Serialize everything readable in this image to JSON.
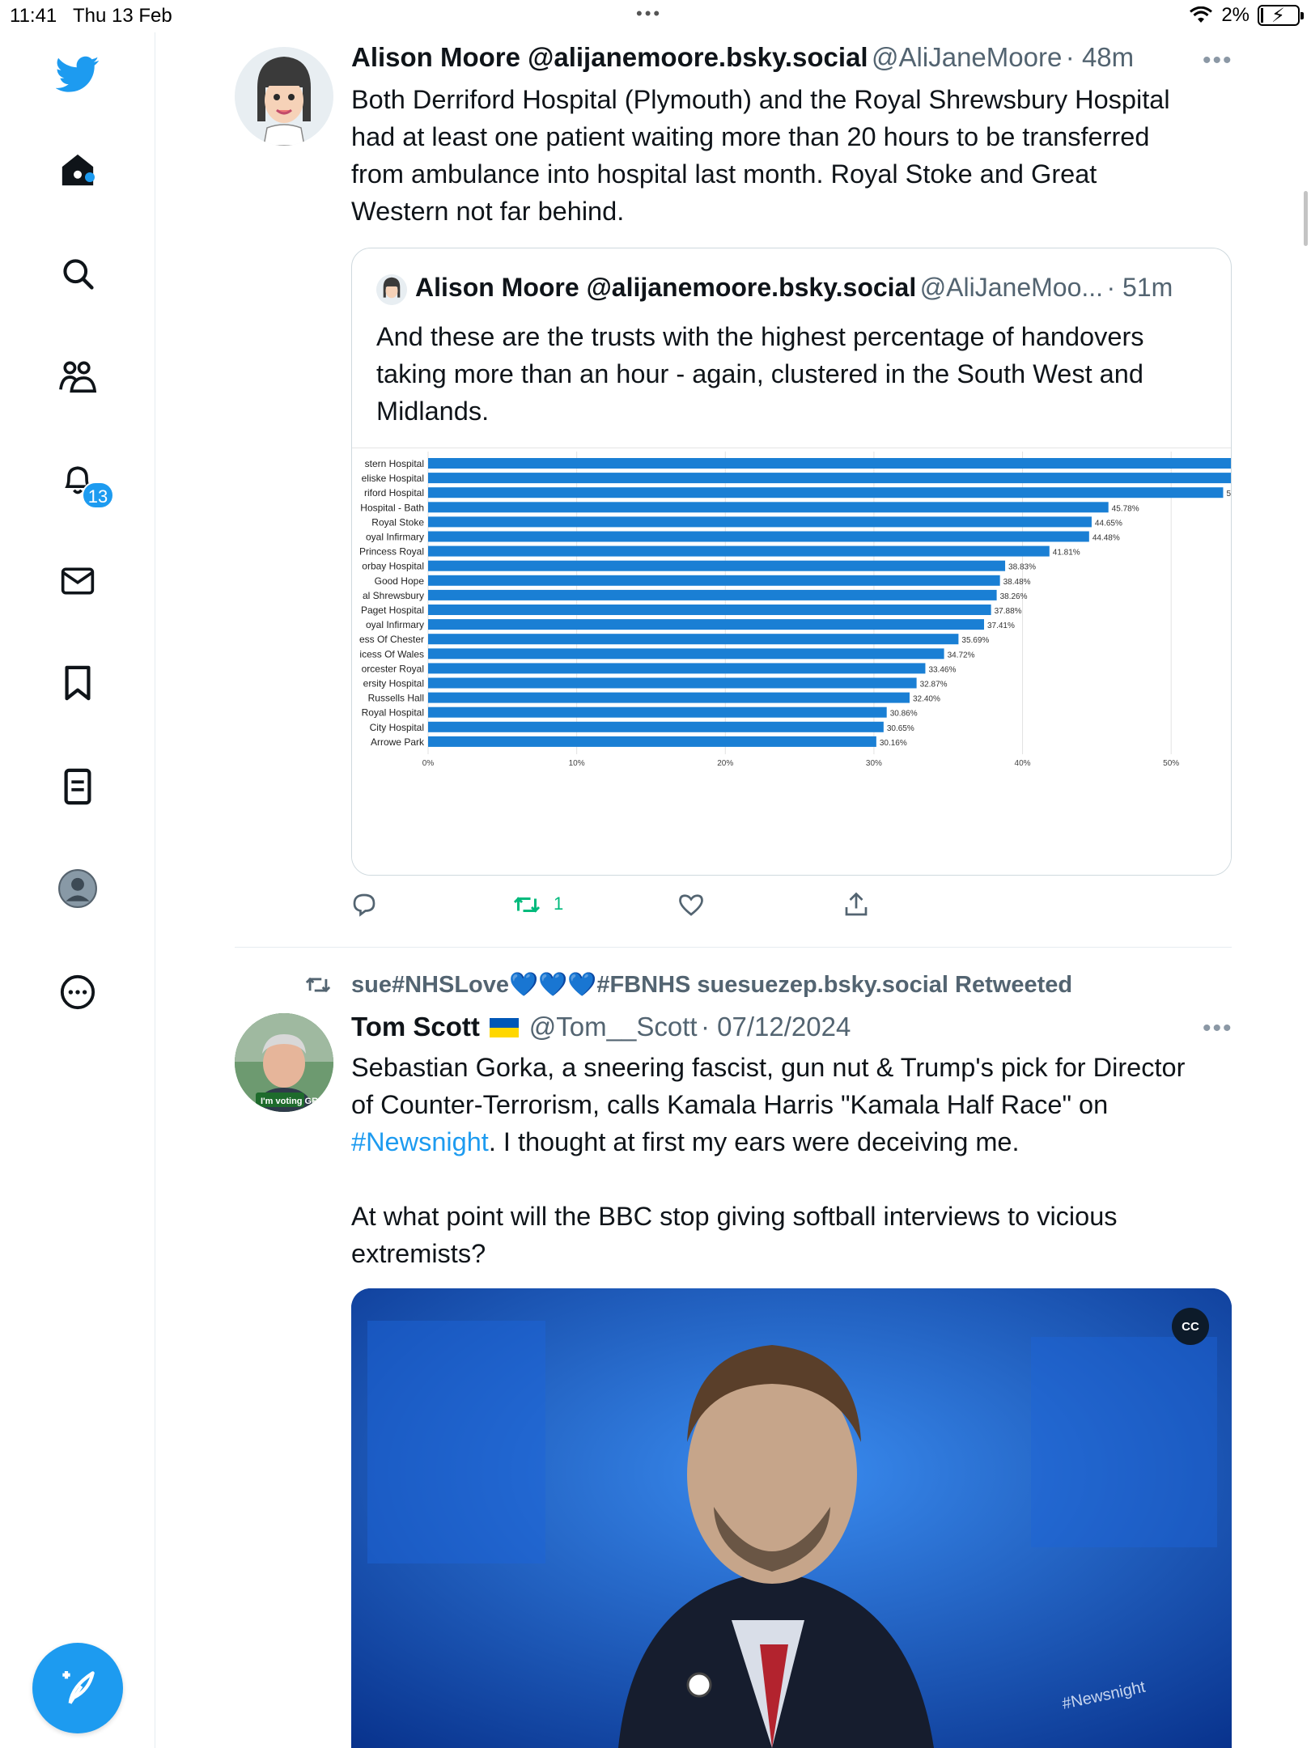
{
  "status_bar": {
    "time": "11:41",
    "date": "Thu 13 Feb",
    "battery": "2%"
  },
  "sidebar": {
    "notifications_count": "13"
  },
  "tweet1": {
    "name": "Alison Moore @alijanemoore.bsky.social",
    "handle": "@AliJaneMoore",
    "time": "· 48m",
    "text_lines": [
      "Both Derriford Hospital (Plymouth) and the Royal Shrewsbury Hospital",
      "had at least one patient waiting more than 20 hours to be transferred",
      "from ambulance into hospital last month.  Royal Stoke and Great",
      "Western not far behind."
    ],
    "retweet_count": "1",
    "quote": {
      "name": "Alison Moore @alijanemoore.bsky.social",
      "handle": "@AliJaneMoo...",
      "time": "· 51m",
      "text_lines": [
        "And these are the trusts with the highest percentage of handovers",
        "taking more than an hour - again, clustered in the South West and",
        "Midlands."
      ]
    }
  },
  "chart_data": {
    "type": "bar",
    "orientation": "horizontal",
    "categories": [
      "stern Hospital",
      "eliske Hospital",
      "riford Hospital",
      "Hospital - Bath",
      "Royal Stoke",
      "oyal Infirmary",
      "Princess Royal",
      "orbay Hospital",
      "Good Hope",
      "al Shrewsbury",
      "Paget Hospital",
      "oyal Infirmary",
      "ess Of Chester",
      "icess Of Wales",
      "orcester Royal",
      "ersity Hospital",
      "Russells Hall",
      "Royal Hospital",
      "City Hospital",
      "Arrowe Park"
    ],
    "values": [
      56,
      56,
      53.5,
      45.78,
      44.65,
      44.48,
      41.81,
      38.83,
      38.48,
      38.26,
      37.88,
      37.41,
      35.69,
      34.72,
      33.46,
      32.87,
      32.4,
      30.86,
      30.65,
      30.16
    ],
    "data_labels": [
      "",
      "",
      "5",
      "45.78%",
      "44.65%",
      "44.48%",
      "41.81%",
      "38.83%",
      "38.48%",
      "38.26%",
      "37.88%",
      "37.41%",
      "35.69%",
      "34.72%",
      "33.46%",
      "32.87%",
      "32.40%",
      "30.86%",
      "30.65%",
      "30.16%"
    ],
    "x_ticks": [
      "0%",
      "10%",
      "20%",
      "30%",
      "40%",
      "50%"
    ],
    "xlim": [
      0,
      55
    ],
    "bar_color": "#1a7fd4"
  },
  "tweet2": {
    "retweeted_by": "sue#NHSLove💙💙💙#FBNHS suesuezep.bsky.social Retweeted",
    "name": "Tom Scott",
    "handle": "@Tom__Scott",
    "time": "· 07/12/2024",
    "line1": "Sebastian Gorka, a sneering fascist, gun nut & Trump's pick for Director",
    "line2": "of Counter-Terrorism, calls Kamala Harris \"Kamala Half Race\" on",
    "hashtag": "#Newsnight",
    "line3_rest": ". I thought at first my ears were deceiving me.",
    "line4": "At what point will the BBC stop giving softball interviews to vicious",
    "line5": "extremists?",
    "avatar_badge": "I'm voting GREEN",
    "media_watermark": "#Newsnight",
    "cc_label": "CC"
  }
}
